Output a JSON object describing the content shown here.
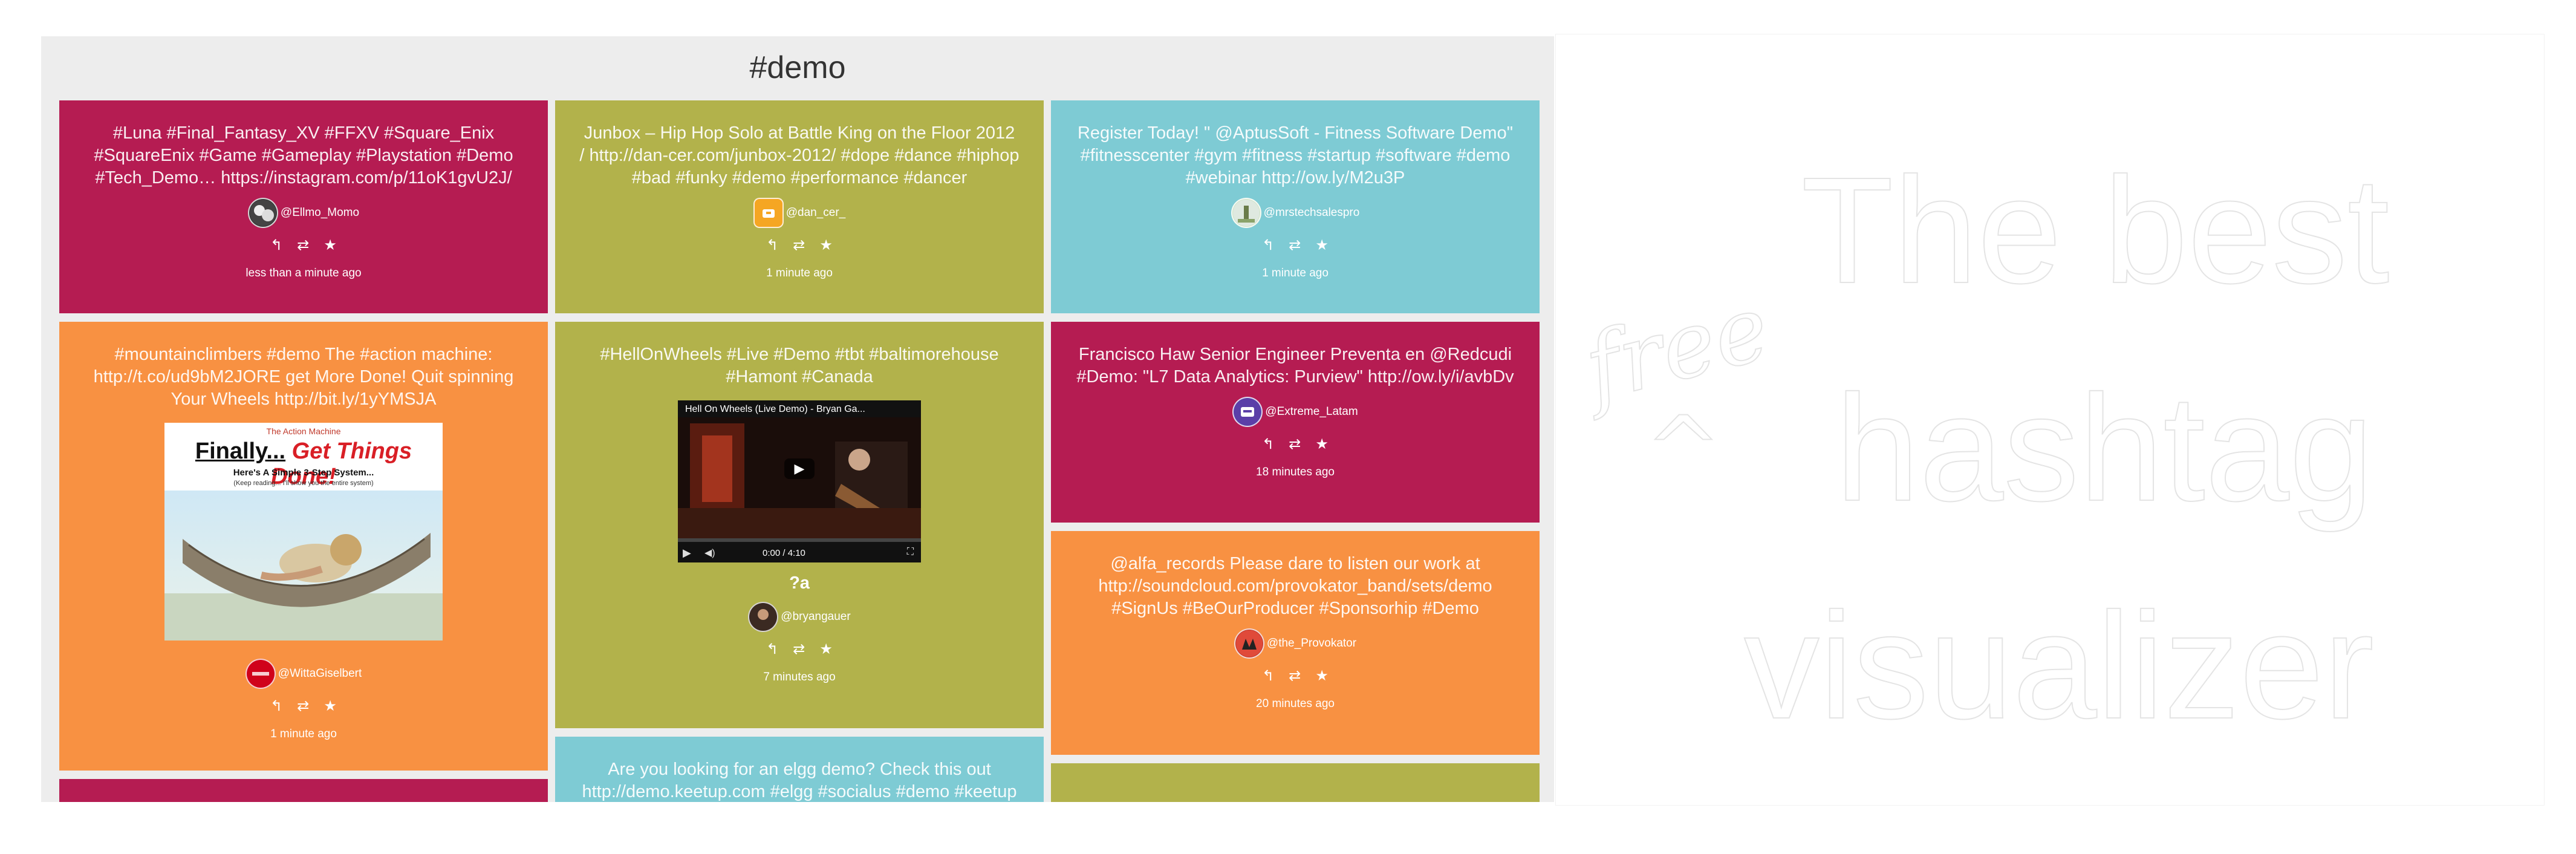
{
  "feed": {
    "title": "#demo",
    "cards": [
      {
        "color": "#b51c52",
        "text": "#Luna #Final_Fantasy_XV #FFXV #Square_Enix #SquareEnix #Game #Gameplay #Playstation #Demo #Tech_Demo… https://instagram.com/p/11oK1gvU2J/",
        "author": "@Ellmo_Momo",
        "time": "less than a minute ago"
      },
      {
        "color": "#b2b24b",
        "text": "Junbox – Hip Hop Solo at Battle King on the Floor 2012 / http://dan-cer.com/junbox-2012/ #dope #dance #hiphop #bad #funky #demo #performance #dancer",
        "author": "@dan_cer_",
        "time": "1 minute ago"
      },
      {
        "color": "#7ecbd4",
        "text": "Register Today! \" @AptusSoft - Fitness Software Demo\" #fitnesscenter #gym #fitness #startup #software #demo #webinar http://ow.ly/M2u3P",
        "author": "@mrstechsalespro",
        "time": "1 minute ago"
      },
      {
        "color": "#f89142",
        "text": "#mountainclimbers #demo The #action machine: http://t.co/ud9bM2JORE get More Done! Quit spinning Your Wheels http://bit.ly/1yYMSJA",
        "author": "@WittaGiselbert",
        "time": "1 minute ago",
        "media": {
          "brand": "The Action Machine",
          "headline_1": "Finally...",
          "headline_2": "Get Things Done!",
          "subhead": "Here's A Simple 3-Step System...",
          "note": "(Keep reading... I'll show you the entire system)"
        }
      },
      {
        "color": "#b2b24b",
        "text": "#HellOnWheels #Live #Demo #tbt #baltimorehouse #Hamont #Canada",
        "author": "@bryangauer",
        "time": "7 minutes ago",
        "extra": "?a",
        "video": {
          "title": "Hell On Wheels (Live Demo) - Bryan Ga...",
          "time": "0:00 / 4:10"
        }
      },
      {
        "color": "#b51c52",
        "text": "Francisco Haw Senior Engineer Preventa en @Redcudi #Demo: \"L7 Data Analytics: Purview\" http://ow.ly/i/avbDv",
        "author": "@Extreme_Latam",
        "time": "18 minutes ago"
      },
      {
        "color": "#f89142",
        "text": "@alfa_records Please dare to listen our work at http://soundcloud.com/provokator_band/sets/demo #SignUs #BeOurProducer #Sponsorhip #Demo",
        "author": "@the_Provokator",
        "time": "20 minutes ago"
      },
      {
        "color": "#7ecbd4",
        "text": "Are you looking for an elgg demo? Check this out http://demo.keetup.com #elgg #socialus #demo #keetup"
      }
    ],
    "actions": {
      "reply": "↰",
      "retweet": "⇄",
      "favorite": "★"
    }
  },
  "brand": {
    "tagline_small": "free",
    "caret": "^",
    "line_1": "The best",
    "line_2": "hashtag",
    "line_3": "visualizer"
  }
}
